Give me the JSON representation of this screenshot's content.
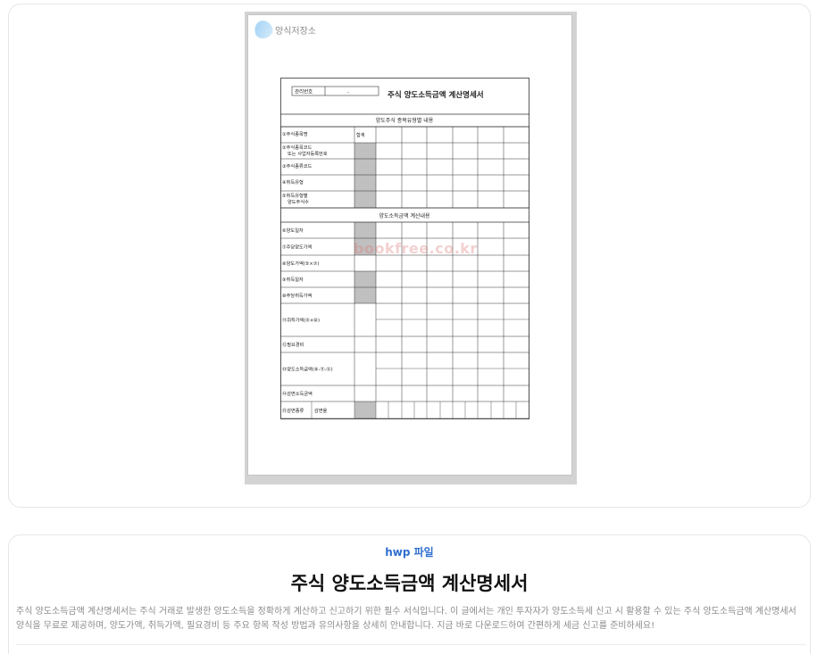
{
  "preview": {
    "logo_text": "양식저장소",
    "watermark": "bookfree.co.kr",
    "form": {
      "serial_label": "관리번호",
      "serial_value": "-",
      "title": "주식 양도소득금액 계산명세서",
      "section1": "양도주식 종목유형별 내용",
      "section2": "양도소득금액 계산내용",
      "total_label": "합계",
      "rows1": [
        "①주식종목명",
        "②주식종목코드 또는 사업자등록번호",
        "③주식종류코드",
        "④취득유형",
        "⑤취득유형별 양도주식수"
      ],
      "rows2": [
        "⑥양도일자",
        "⑦주당양도가액",
        "⑧양도가액(⑤×⑦)",
        "⑨취득일자",
        "⑩주당취득가액",
        "⑪취득가액(⑤×⑩)",
        "⑫필요경비",
        "⑬양도소득금액(⑧-⑪-⑫)",
        "⑭감면소득금액"
      ],
      "last_row_a": "⑮감면종류",
      "last_row_b": "감면율"
    }
  },
  "info": {
    "file_type": "hwp 파일",
    "title": "주식 양도소득금액 계산명세서",
    "description": "주식 양도소득금액 계산명세서는 주식 거래로 발생한 양도소득을 정확하게 계산하고 신고하기 위한 필수 서식입니다. 이 글에서는 개인 투자자가 양도소득세 신고 시 활용할 수 있는 주식 양도소득금액 계산명세서 양식을 무료로 제공하며, 양도가액, 취득가액, 필요경비 등 주요 항목 작성 방법과 유의사항을 상세히 안내합니다. 지금 바로 다운로드하여 간편하게 세금 신고를 준비하세요!"
  }
}
